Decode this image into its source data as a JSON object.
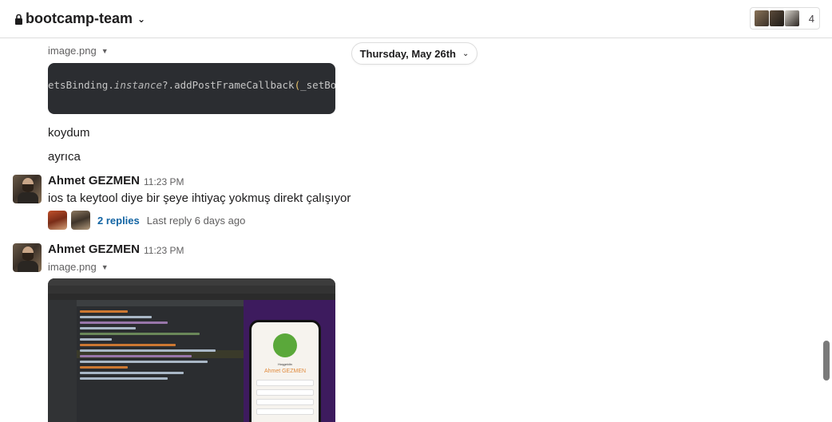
{
  "header": {
    "channel_name": "bootcamp-team",
    "member_count": "4"
  },
  "date_divider": {
    "label": "Thursday, May 26th"
  },
  "messages": [
    {
      "attachment_label": "image.png",
      "code_preview": {
        "prefix": "etsBinding.",
        "instance": "instance",
        "middle": "?.addPostFrameCallback",
        "paren": "(",
        "suffix": "_setBoun"
      }
    },
    {
      "text": "koydum"
    },
    {
      "text": "ayrıca"
    },
    {
      "sender": "Ahmet GEZMEN",
      "time": "11:23 PM",
      "text": "ios ta keytool diye bir şeye ihtiyaç yokmuş direkt çalışıyor",
      "thread": {
        "replies_label": "2 replies",
        "last_reply": "Last reply 6 days ago"
      }
    },
    {
      "sender": "Ahmet GEZMEN",
      "time": "11:23 PM",
      "attachment_label": "image.png",
      "screenshot_preview": {
        "greeting": "Hoşgeldin",
        "profile_name": "Ahmet GEZMEN"
      }
    }
  ],
  "colors": {
    "link": "#1264a3",
    "text": "#1d1c1d",
    "muted": "#616061"
  }
}
